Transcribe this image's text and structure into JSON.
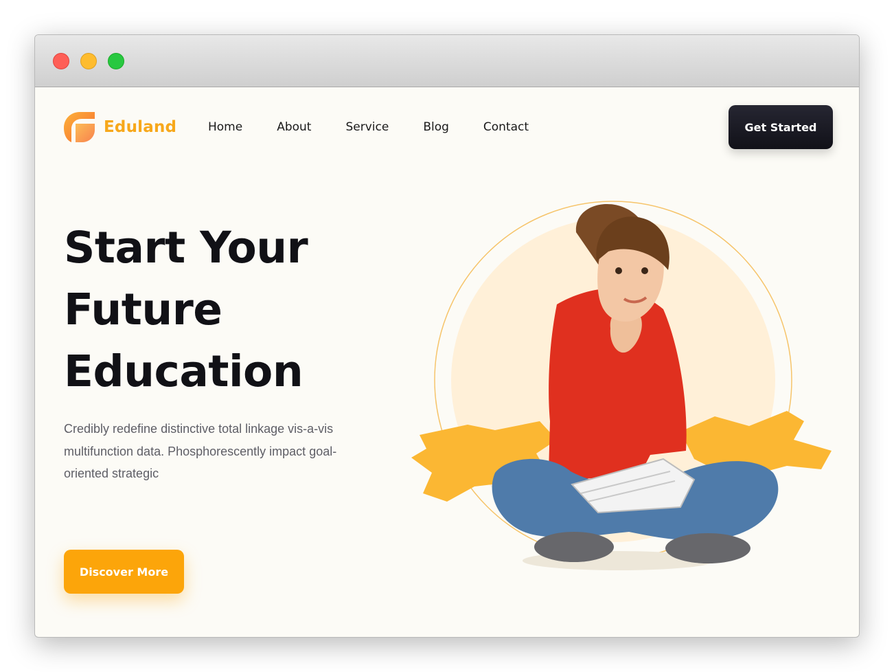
{
  "brand": {
    "name": "Eduland",
    "accent": "#f7a81b",
    "logo_icon": "eduland-logo-icon"
  },
  "nav": {
    "items": [
      {
        "label": "Home"
      },
      {
        "label": "About"
      },
      {
        "label": "Service"
      },
      {
        "label": "Blog"
      },
      {
        "label": "Contact"
      }
    ],
    "cta_label": "Get Started"
  },
  "hero": {
    "headline": [
      "Start Your",
      "Future",
      "Education"
    ],
    "description": "Credibly redefine distinctive total linkage vis-a-vis multifunction data. Phosphorescently impact goal-oriented strategic",
    "button_label": "Discover More",
    "button_color": "#fca50a",
    "image": "student-with-pencil-and-notebook-illustration"
  }
}
